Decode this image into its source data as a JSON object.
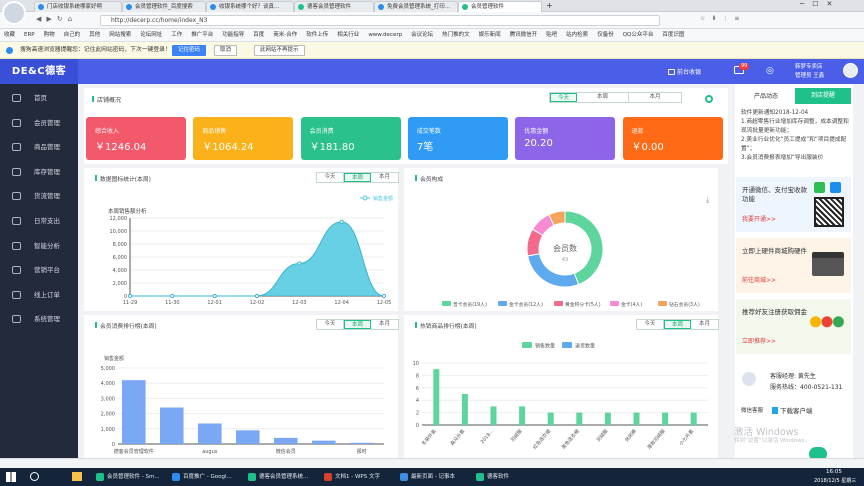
{
  "browser": {
    "tabs": [
      "门店收银系统哪家好啊",
      "会员管理软件_百度搜索",
      "收银系统哪个好？谈真...",
      "德客会员管理软件",
      "免费会员管理系统_打印...",
      "会员管理软件"
    ],
    "url": "http://decerp.cc/home/index_N3",
    "bookmarks": [
      "收藏",
      "ERP",
      "购物",
      "自己的",
      "其他",
      "网站搜索",
      "论坛网址",
      "工作",
      "推广平台",
      "功能指导",
      "百度",
      "商米-合作",
      "软件上传",
      "相关行业",
      "www.decerp",
      "会议论坛",
      "热门推的文",
      "娱乐新闻",
      "腾讯微信开",
      "贴吧",
      "站内检索",
      "仅备份",
      "QQ公众平台",
      "百度识图"
    ]
  },
  "notice": {
    "text": "搜狗高速浏览器提醒您：记住此网站密码，下次一键登录！",
    "btn_remember": "记住密码",
    "btn_cancel": "取消",
    "btn_never": "此网站不再提示"
  },
  "header": {
    "logo": "DE&C德客",
    "cashier": "前台收银",
    "msg_badge": "99",
    "user_name": "韩梦专卖店",
    "user_role": "管理员 王鑫"
  },
  "sidebar": {
    "items": [
      {
        "label": "首页",
        "icon": "chart-bar-icon"
      },
      {
        "label": "会员管理",
        "icon": "user-icon"
      },
      {
        "label": "商品管理",
        "icon": "box-icon"
      },
      {
        "label": "库存管理",
        "icon": "layers-icon"
      },
      {
        "label": "货流管理",
        "icon": "truck-icon"
      },
      {
        "label": "日常支出",
        "icon": "wallet-icon"
      },
      {
        "label": "智能分析",
        "icon": "analysis-icon"
      },
      {
        "label": "营销平台",
        "icon": "gift-icon"
      },
      {
        "label": "线上订单",
        "icon": "cart-icon"
      },
      {
        "label": "系统管理",
        "icon": "gear-icon"
      }
    ]
  },
  "overview": {
    "title": "店铺概况",
    "tabs": [
      "今天",
      "本周",
      "本月"
    ],
    "active_tab": "今天",
    "cards": [
      {
        "label": "综合收入",
        "value": "￥1246.04",
        "color": "#f25a6b"
      },
      {
        "label": "商品销售",
        "value": "￥1064.24",
        "color": "#fbb11a"
      },
      {
        "label": "会员消费",
        "value": "￥181.80",
        "color": "#2ac28a"
      },
      {
        "label": "成交笔数",
        "value": "7笔",
        "color": "#2f9bf5"
      },
      {
        "label": "优惠金额",
        "value": "20.20",
        "color": "#8c65e8"
      },
      {
        "label": "退款",
        "value": "￥0.00",
        "color": "#ff6a16"
      }
    ]
  },
  "panels": {
    "sales_stats_title": "数据图标统计(本周)",
    "member_comp_title": "会员构成",
    "member_rank_title": "会员消费排行榜(本周)",
    "hot_goods_title": "热销商品排行榜(本周)",
    "tabs": [
      "今天",
      "本周",
      "本月"
    ],
    "active": "本周"
  },
  "right": {
    "tab_news": "产品动态",
    "tab_remind": "到店提醒",
    "news": "软件更新通知2018-12-04\n1.商超零售行业增加库存调整，成本调整和现流批量更新功能；\n2.美业行业优化“员工提成”和“项目提成配置”；\n3.会员消费报表增加“导出服装价",
    "promos": [
      {
        "text": "开通微信、支付宝收款功能",
        "link": "我要开通>>",
        "icon": "qr-code-icon"
      },
      {
        "text": "立即上硬件商城购硬件",
        "link": "前往商城>>",
        "icon": "pos-hardware-icon"
      },
      {
        "text": "推荐好友注册获取佣金",
        "link": "立即推荐>>",
        "icon": "people-group-icon"
      }
    ],
    "service_manager": "客服经理: 黄先生",
    "service_hotline": "服务热线：400-0521-131",
    "wechat_service": "微信客服",
    "download_app": "下载客户端",
    "watermark1": "激活 Windows",
    "watermark2": "转到“设置”以激活 Windows。"
  },
  "taskbar": {
    "items": [
      "会员管理软件 - Sm...",
      "百度推广 - Googl...",
      "德客会员管理系统...",
      "文档1 - WPS 文字",
      "最新页面 - 记事本",
      "德客软件"
    ],
    "time": "16:05",
    "date": "2018/12/5 星期三"
  },
  "chart_data": [
    {
      "type": "area",
      "title": "本周销售额分析",
      "legend": "销售金额",
      "x": [
        "11-29",
        "11-30",
        "12-01",
        "12-02",
        "12-03",
        "12-04",
        "12-05"
      ],
      "values": [
        0,
        0,
        0,
        0,
        5000,
        11400,
        0
      ],
      "ylim": [
        0,
        12000
      ],
      "yticks": [
        0,
        2000,
        4000,
        6000,
        8000,
        10000,
        12000
      ],
      "color": "#4cc8e0"
    },
    {
      "type": "pie",
      "center_label": "会员数",
      "center_value": "43",
      "slices": [
        {
          "name": "普卡会员",
          "count": 19,
          "color": "#5ed59c"
        },
        {
          "name": "金卡会员",
          "count": 12,
          "color": "#5fa9ef"
        },
        {
          "name": "黄金积分卡",
          "count": 5,
          "color": "#f26b8c"
        },
        {
          "name": "金卡",
          "count": 4,
          "color": "#f78bd1"
        },
        {
          "name": "钻石会员",
          "count": 3,
          "color": "#f6a35d"
        }
      ],
      "legend_labels": [
        "普卡会员(19人)",
        "金卡会员(12人)",
        "黄金积分卡(5人)",
        "金卡(4人)",
        "钻石会员(3人)"
      ]
    },
    {
      "type": "bar",
      "ylabel": "销售金额",
      "categories": [
        "德客会员管理软件",
        "",
        "augus",
        "",
        "微信会员",
        "",
        "报时"
      ],
      "values": [
        4200,
        2400,
        1350,
        900,
        400,
        220,
        80
      ],
      "ylim": [
        0,
        5000
      ],
      "yticks": [
        0,
        1000,
        2000,
        3000,
        4000,
        5000
      ],
      "color": "#7aa8f5"
    },
    {
      "type": "bar",
      "legend": [
        "销售数量",
        "退货数量"
      ],
      "categories": [
        "冬装外套",
        "森马外套",
        "2018...",
        "羽绒服",
        "红色连衣裙",
        "黑色连衣裙",
        "羽绒服",
        "休闲裤",
        "厚款羽绒服",
        "小七外套"
      ],
      "values": [
        9,
        5,
        3,
        3,
        2,
        2,
        2,
        2,
        2,
        2
      ],
      "returns": [
        0,
        0,
        0,
        0,
        0,
        0,
        0,
        0,
        0,
        0
      ],
      "ylim": [
        0,
        10
      ],
      "yticks": [
        0,
        2,
        4,
        6,
        8,
        10
      ],
      "colors": [
        "#5ed59c",
        "#5fa9ef"
      ]
    }
  ]
}
